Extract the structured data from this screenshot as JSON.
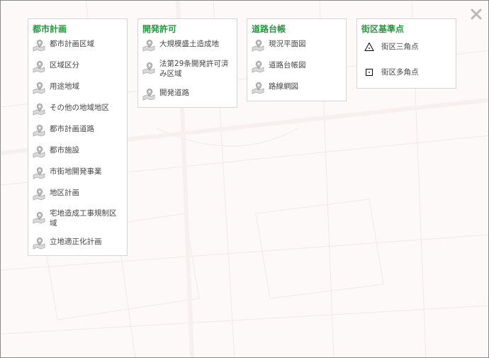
{
  "panels": [
    {
      "title": "都市計画",
      "items": [
        "都市計画区域",
        "区域区分",
        "用途地域",
        "その他の地域地区",
        "都市計画道路",
        "都市施設",
        "市街地開発事業",
        "地区計画",
        "宅地造成工事規制区域",
        "立地適正化計画"
      ],
      "icon": "map-layer-pin-icon"
    },
    {
      "title": "開発許可",
      "items": [
        "大規模盛土造成地",
        "法第29条開発許可済み区域",
        "開発道路"
      ],
      "icon": "map-layer-pin-icon"
    },
    {
      "title": "道路台帳",
      "items": [
        "現況平面図",
        "道路台帳図",
        "路線網図"
      ],
      "icon": "map-layer-pin-icon"
    },
    {
      "title": "街区基準点",
      "items": [
        "街区三角点",
        "街区多角点"
      ],
      "icons": [
        "triangle-point-icon",
        "polygon-point-icon"
      ]
    }
  ],
  "close_icon": "close-icon",
  "colors": {
    "title": "#1f9a3a",
    "text": "#444444",
    "border": "#d4d4d4"
  }
}
